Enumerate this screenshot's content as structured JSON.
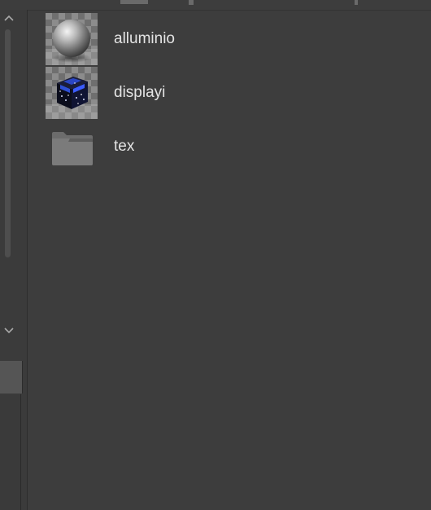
{
  "files": [
    {
      "name": "alluminio",
      "type": "material",
      "icon": "sphere-thumbnail-icon"
    },
    {
      "name": "displayi",
      "type": "material",
      "icon": "cube-thumbnail-icon"
    },
    {
      "name": "tex",
      "type": "folder",
      "icon": "folder-icon"
    }
  ],
  "colors": {
    "background": "#3d3d3d",
    "text": "#e4e4e4",
    "folder": "#7a7a7a"
  }
}
